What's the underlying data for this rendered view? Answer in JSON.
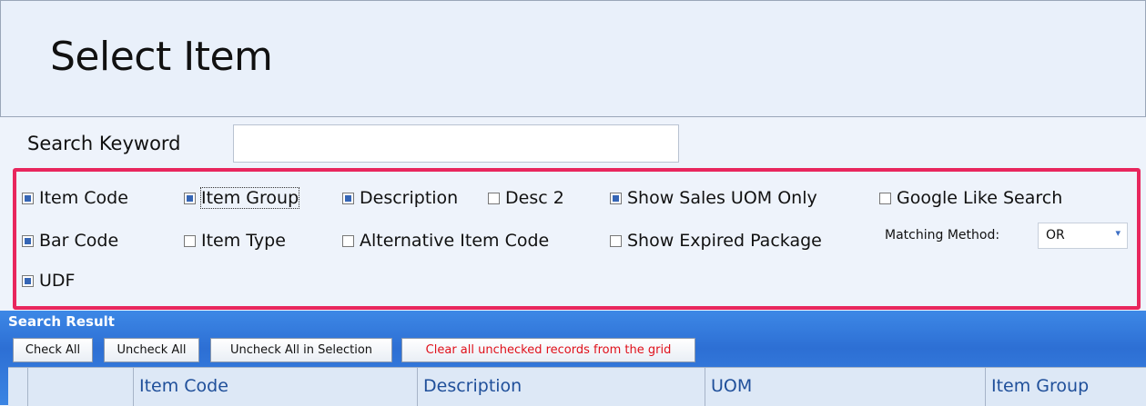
{
  "header": {
    "title": "Select Item"
  },
  "search": {
    "keyword_label": "Search Keyword",
    "keyword_value": ""
  },
  "options": {
    "item_code": {
      "label": "Item Code",
      "checked": true
    },
    "item_group": {
      "label": "Item Group",
      "checked": true
    },
    "description": {
      "label": "Description",
      "checked": true
    },
    "desc2": {
      "label": "Desc 2",
      "checked": false
    },
    "show_sales_uom_only": {
      "label": "Show Sales UOM Only",
      "checked": true
    },
    "google_like_search": {
      "label": "Google Like Search",
      "checked": false
    },
    "bar_code": {
      "label": "Bar Code",
      "checked": true
    },
    "item_type": {
      "label": "Item Type",
      "checked": false
    },
    "alternative_item_code": {
      "label": "Alternative Item Code",
      "checked": false
    },
    "show_expired_package": {
      "label": "Show Expired Package",
      "checked": false
    },
    "udf": {
      "label": "UDF",
      "checked": true
    },
    "matching_method_label": "Matching Method:",
    "matching_method_value": "OR"
  },
  "results": {
    "title": "Search Result",
    "buttons": {
      "check_all": "Check All",
      "uncheck_all": "Uncheck All",
      "uncheck_all_selection": "Uncheck All in Selection",
      "clear_unchecked": "Clear all unchecked records from the grid"
    },
    "columns": [
      "Item Code",
      "Description",
      "UOM",
      "Item Group"
    ]
  },
  "colors": {
    "highlight_border": "#e8265d",
    "accent_blue": "#2d6fd4",
    "red_text": "#e0101a"
  }
}
